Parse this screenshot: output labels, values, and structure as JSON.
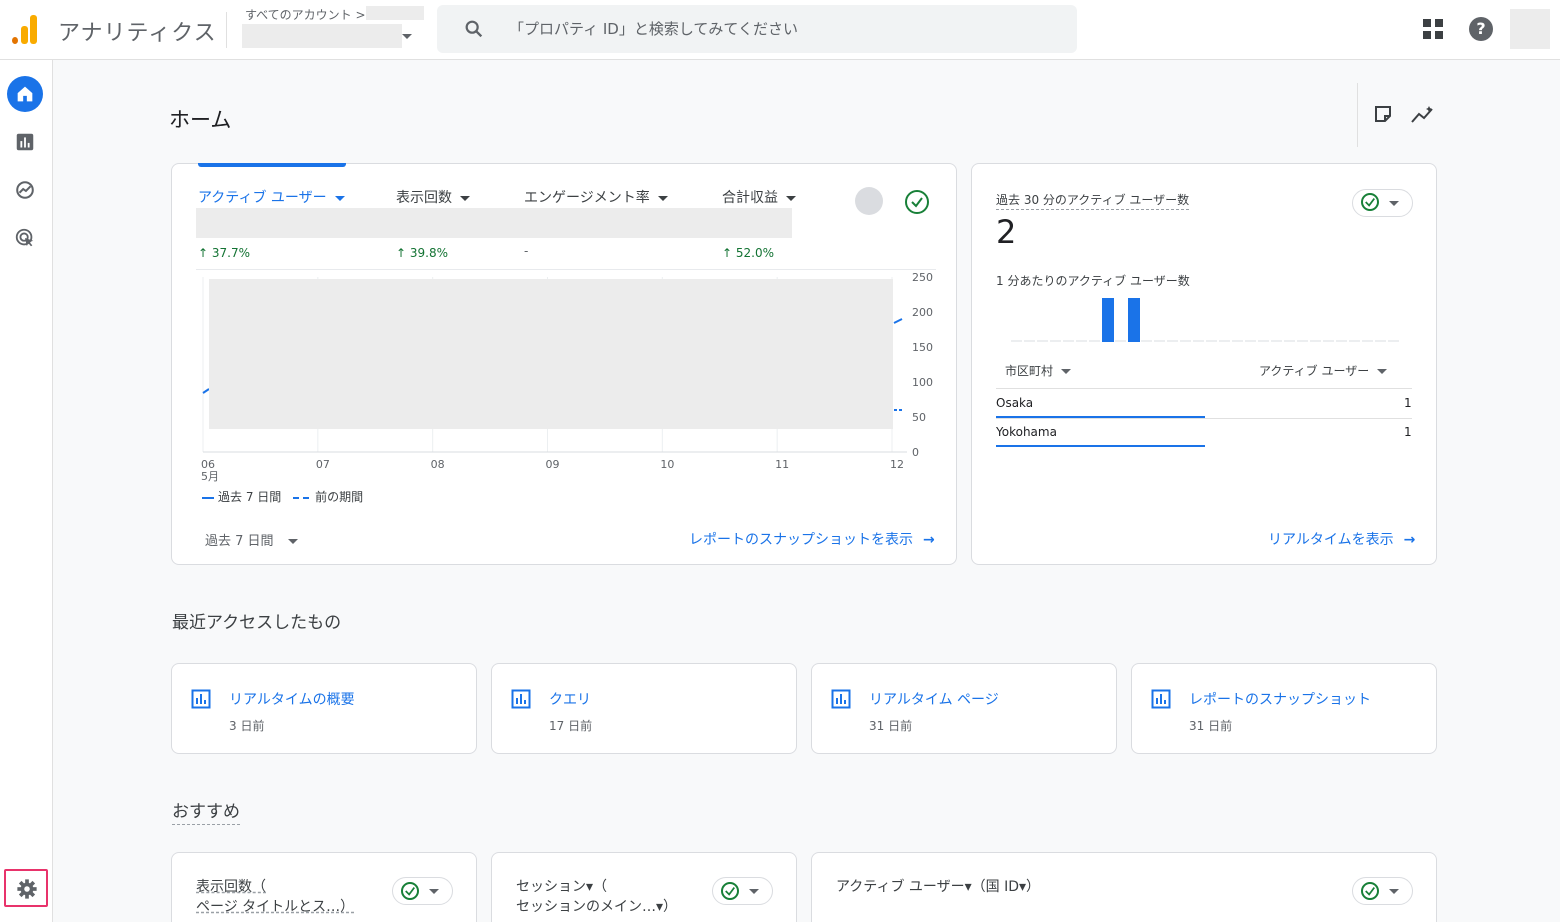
{
  "app": {
    "title": "アナリティクス"
  },
  "account": {
    "crumb": "すべてのアカウント >"
  },
  "search": {
    "placeholder": "「プロパティ ID」と検索してみてください"
  },
  "header": {
    "title": "ホーム"
  },
  "metrics": {
    "tabs": [
      {
        "label": "アクティブ ユーザー",
        "delta": "↑ 37.7%"
      },
      {
        "label": "表示回数",
        "delta": "↑ 39.8%"
      },
      {
        "label": "エンゲージメント率",
        "delta": "-"
      },
      {
        "label": "合計収益",
        "delta": "↑ 52.0%"
      }
    ],
    "legend": {
      "current": "過去 7 日間",
      "previous": "前の期間"
    },
    "range": "過去 7 日間",
    "report_link": "レポートのスナップショットを表示",
    "arrow": "→"
  },
  "chart_data": {
    "type": "line",
    "categories": [
      "06",
      "07",
      "08",
      "09",
      "10",
      "11",
      "12"
    ],
    "x_month_label": "5月",
    "y_ticks": [
      0,
      50,
      100,
      150,
      200,
      250
    ],
    "ylim": [
      0,
      250
    ],
    "series": [
      {
        "name": "過去 7 日間",
        "style": "solid",
        "color": "#1a73e8",
        "visible_points": {
          "start": 90,
          "end": 190
        }
      },
      {
        "name": "前の期間",
        "style": "dashed",
        "color": "#1a73e8",
        "visible_points": {
          "end": 60
        }
      }
    ],
    "note": "chart body obscured by grey redaction rectangle"
  },
  "realtime": {
    "title": "過去 30 分のアクティブ ユーザー数",
    "count": "2",
    "subtitle": "1 分あたりのアクティブ ユーザー数",
    "per_minute": [
      0,
      0,
      0,
      0,
      0,
      0,
      0,
      1,
      0,
      1,
      0,
      0,
      0,
      0,
      0,
      0,
      0,
      0,
      0,
      0,
      0,
      0,
      0,
      0,
      0,
      0,
      0,
      0,
      0,
      0
    ],
    "col_city": "市区町村",
    "col_users": "アクティブ ユーザー",
    "rows": [
      {
        "city": "Osaka",
        "value": "1"
      },
      {
        "city": "Yokohama",
        "value": "1"
      }
    ],
    "link": "リアルタイムを表示",
    "arrow": "→"
  },
  "recent": {
    "title": "最近アクセスしたもの",
    "items": [
      {
        "name": "リアルタイムの概要",
        "time": "3 日前"
      },
      {
        "name": "クエリ",
        "time": "17 日前"
      },
      {
        "name": "リアルタイム ページ",
        "time": "31 日前"
      },
      {
        "name": "レポートのスナップショット",
        "time": "31 日前"
      }
    ]
  },
  "recommendations": {
    "title": "おすすめ",
    "cards": [
      {
        "line1": "表示回数（",
        "line2": "ページ タイトルとス…）"
      },
      {
        "line1": "セッション▾（",
        "line2": "セッションのメイン…▾）"
      },
      {
        "line1": "アクティブ ユーザー▾（国 ID▾）",
        "line2": ""
      }
    ]
  },
  "colors": {
    "accent": "#1a73e8",
    "positive": "#137333",
    "admin_highlight": "#e8336b"
  }
}
